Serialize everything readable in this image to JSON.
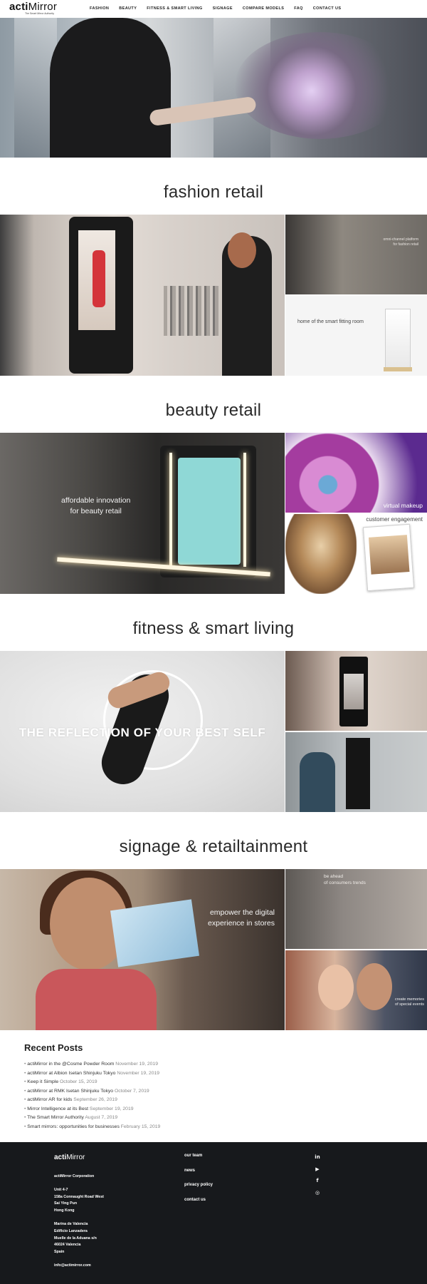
{
  "nav": {
    "logo_bold": "acti",
    "logo_rest": "Mirror",
    "logo_tagline": "The Smart Mirror Authority",
    "items": [
      "FASHION",
      "BEAUTY",
      "FITNESS & SMART LIVING",
      "SIGNAGE",
      "COMPARE MODELS",
      "FAQ",
      "CONTACT US"
    ]
  },
  "sections": {
    "fashion": {
      "title": "fashion retail",
      "tr_caption_1": "omni-channel platform",
      "tr_caption_2": "for fashion retail",
      "br_caption": "home of the smart fitting room"
    },
    "beauty": {
      "title": "beauty retail",
      "main_caption_1": "affordable innovation",
      "main_caption_2": "for beauty retail",
      "tr_caption": "virtual makeup",
      "br_caption": "customer engagement"
    },
    "fitness": {
      "title": "fitness & smart living",
      "main_caption": "THE REFLECTION OF YOUR BEST SELF"
    },
    "signage": {
      "title": "signage & retailtainment",
      "main_caption_1": "empower the digital",
      "main_caption_2": "experience in stores",
      "tr_caption_1": "be ahead",
      "tr_caption_2": "of consumers trends",
      "br_caption_1": "create memories",
      "br_caption_2": "of special events"
    }
  },
  "recent_posts": {
    "title": "Recent Posts",
    "items": [
      {
        "title": "actiMirror in the @Cosme Powder Room",
        "date": "November 19, 2019"
      },
      {
        "title": "actiMirror at Albion Isetan Shinjuku Tokyo",
        "date": "November 19, 2019"
      },
      {
        "title": "Keep it Simple",
        "date": "October 15, 2019"
      },
      {
        "title": "actiMirror at RMK Isetan Shinjuku Tokyo",
        "date": "October 7, 2019"
      },
      {
        "title": "actiMirror AR for kids",
        "date": "September 26, 2019"
      },
      {
        "title": "Mirror Intelligence at its Best",
        "date": "September 19, 2019"
      },
      {
        "title": "The Smart Mirror Authority",
        "date": "August 7, 2019"
      },
      {
        "title": "Smart mirrors: opportunities for businesses",
        "date": "February 15, 2019"
      }
    ]
  },
  "footer": {
    "logo_bold": "acti",
    "logo_rest": "Mirror",
    "company": "actiMirror Corporation",
    "address_hk": [
      "Unit 4-7",
      "158a Connaught Road West",
      "Sai Ying Pun",
      "Hong Kong"
    ],
    "address_es": [
      "Marina de Valencia",
      "Edificio Lanzadera",
      "Muelle de la Aduana s/n",
      "46024 Valencia",
      "Spain"
    ],
    "email": "info@actimirror.com",
    "links": [
      "our team",
      "news",
      "privacy policy",
      "contact us"
    ],
    "social": [
      "in",
      "▶",
      "f",
      "◎"
    ]
  },
  "colors": {
    "footer_bg": "#17191c",
    "text_dark": "#222222",
    "date_grey": "#888888"
  }
}
